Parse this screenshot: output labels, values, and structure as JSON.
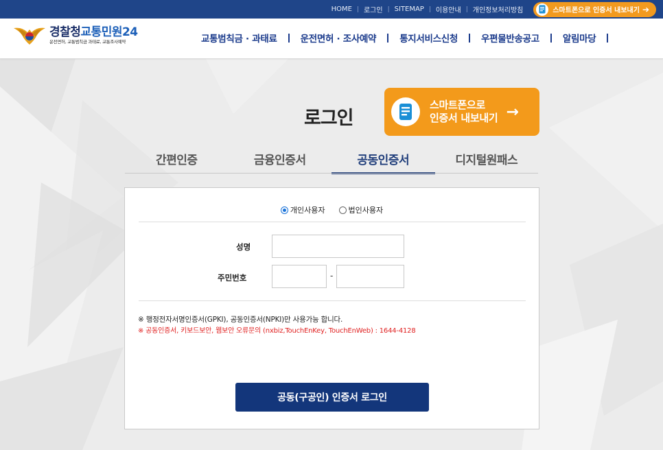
{
  "topbar": {
    "links": [
      "HOME",
      "로그인",
      "SITEMAP",
      "이용안내",
      "개인정보처리방침"
    ],
    "export_label": "스마트폰으로 인증서 내보내기"
  },
  "header": {
    "logo_main_a": "경찰청",
    "logo_main_b": "교통민원24",
    "logo_sub": "운전면허, 교통범칙금 과태료, 교통조사예약",
    "nav": [
      "교통범칙금 · 과태료",
      "운전면허 · 조사예약",
      "통지서비스신청",
      "우편물반송공고",
      "알림마당"
    ]
  },
  "main": {
    "title": "로그인",
    "export_box": {
      "line1": "스마트폰으로",
      "line2": "인증서 내보내기"
    },
    "tabs": [
      "간편인증",
      "금융인증서",
      "공동인증서",
      "디지털원패스"
    ],
    "active_tab": "공동인증서",
    "radios": {
      "personal": "개인사용자",
      "corporate": "법인사용자"
    },
    "fields": {
      "name_label": "성명",
      "rrn_label": "주민번호",
      "dash": "-"
    },
    "notice1": "※ 행정전자서명인증서(GPKI), 공동인증서(NPKI)만 사용가능 합니다.",
    "notice2": "※ 공동인증서, 키보드보안, 웹보안 오류문의 (nxbiz,TouchEnKey, TouchEnWeb) : 1644-4128",
    "login_button": "공동(구공인) 인증서 로그인"
  },
  "colors": {
    "topbar": "#1f4589",
    "orange": "#f39a1b",
    "nav_text": "#1b3b8c",
    "button": "#13367b",
    "error": "#e02020"
  }
}
